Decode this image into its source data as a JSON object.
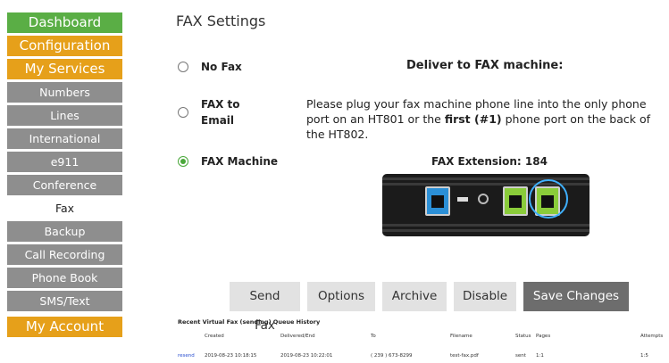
{
  "sidebar": {
    "dashboard": "Dashboard",
    "configuration": "Configuration",
    "my_services": "My Services",
    "items": [
      "Numbers",
      "Lines",
      "International",
      "e911",
      "Conference",
      "Fax",
      "Backup",
      "Call Recording",
      "Phone Book",
      "SMS/Text"
    ],
    "my_account": "My Account",
    "active_item": "Fax",
    "colors": {
      "green": "#5aae45",
      "orange": "#e6a01a",
      "gray": "#8e8e8e"
    }
  },
  "page": {
    "title": "FAX Settings"
  },
  "fax_options": {
    "no_fax": "No Fax",
    "fax_to_email": "FAX to Email",
    "fax_machine": "FAX Machine",
    "selected": "FAX Machine"
  },
  "deliver": {
    "heading": "Deliver to FAX machine:",
    "text_before": "Please plug your fax machine phone line into the only phone port on an HT801 or the ",
    "text_bold": "first (#1)",
    "text_after": " phone port on the back of the HT802.",
    "extension_label": "FAX Extension: 184"
  },
  "device_image": {
    "ports": [
      "ethernet-port",
      "usb-port",
      "power-jack",
      "phone-port-1",
      "phone-port-2"
    ],
    "highlighted_port": "phone-port-1",
    "highlight_color": "#3fb0ff"
  },
  "buttons": {
    "send_fax": "Send Fax",
    "options": "Options",
    "archive": "Archive",
    "disable": "Disable",
    "save_changes": "Save Changes"
  },
  "queue": {
    "title": "Recent Virtual Fax (sending) Queue History",
    "columns": [
      "Created",
      "Delivered/End",
      "To",
      "Filename",
      "Status",
      "Pages",
      "Attempts"
    ],
    "rows": [
      {
        "action": "resend",
        "created": "2019-08-23 10:18:15",
        "delivered": "2019-08-23 10:22:01",
        "to": "( 239 ) 673-8299",
        "filename": "test-fax.pdf",
        "status": "sent",
        "pages": "1:1",
        "attempts": "1:5"
      }
    ]
  }
}
